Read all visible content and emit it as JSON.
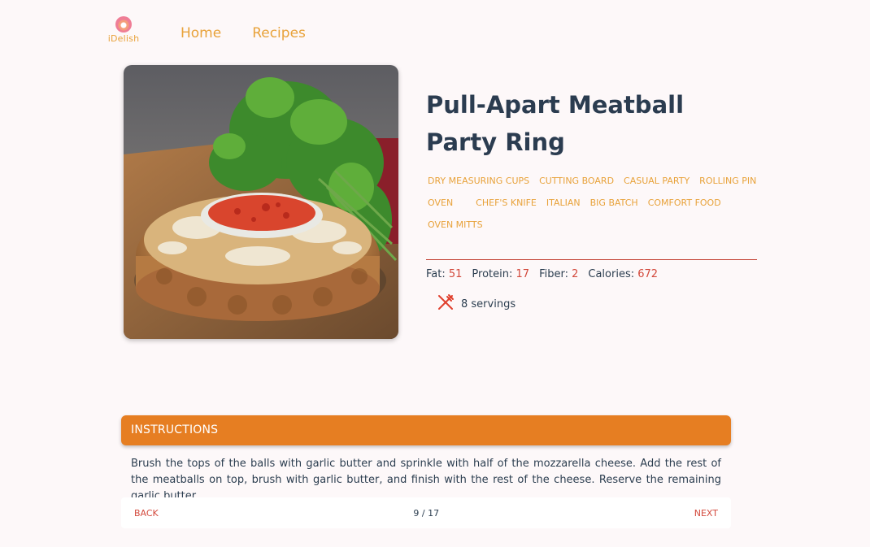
{
  "brand": {
    "name": "iDelish"
  },
  "nav": [
    {
      "label": "Home"
    },
    {
      "label": "Recipes"
    }
  ],
  "recipe": {
    "title": "Pull-Apart Meatball Party Ring",
    "tags": [
      "DRY MEASURING CUPS",
      "CUTTING BOARD",
      "CASUAL PARTY",
      "ROLLING PIN",
      "OVEN",
      "CHEF'S KNIFE",
      "ITALIAN",
      "BIG BATCH",
      "COMFORT FOOD",
      "OVEN MITTS"
    ],
    "nutrition": {
      "fat_label": "Fat:",
      "fat": "51",
      "protein_label": "Protein:",
      "protein": "17",
      "fiber_label": "Fiber:",
      "fiber": "2",
      "calories_label": "Calories:",
      "calories": "672"
    },
    "servings": "8 servings",
    "image_icon": "recipe-photo"
  },
  "instructions": {
    "heading": "INSTRUCTIONS",
    "step_text": "Brush the tops of the balls with garlic butter and sprinkle with half of the mozzarella cheese. Add the rest of the meatballs on top, brush with garlic butter, and finish with the rest of the cheese. Reserve the remaining garlic butter.",
    "back_label": "BACK",
    "next_label": "NEXT",
    "step_counter": "9 / 17"
  },
  "colors": {
    "accent": "#e67e22",
    "link": "#e8a23a",
    "value_red": "#d34a3d",
    "background": "#fdf8f9"
  }
}
